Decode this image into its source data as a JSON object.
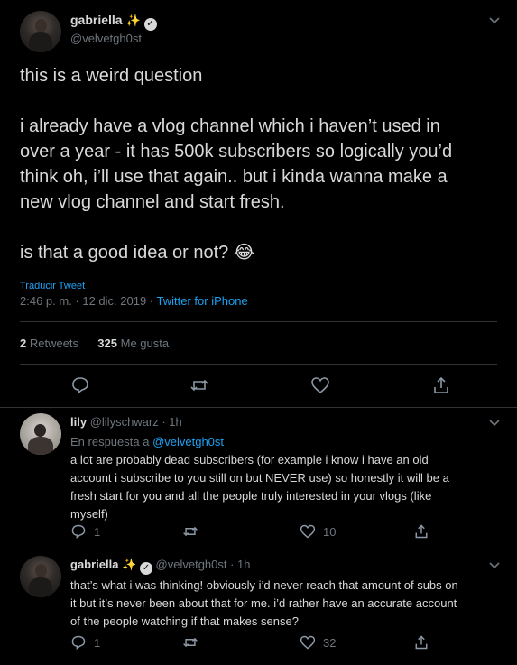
{
  "main_tweet": {
    "display_name": "gabriella",
    "handle": "@velvetgh0st",
    "text_line1": "this is a weird question",
    "text_para2_l1": "i already have a vlog channel which i haven’t used in",
    "text_para2_l2": "over a year - it has 500k subscribers so logically you’d",
    "text_para2_l3": "think oh, i’ll use that again.. but i kinda wanna make a",
    "text_para2_l4": "new vlog channel and start fresh.",
    "text_para3": "is that a good idea or not?",
    "emoji": "😂",
    "translate": "Traducir Tweet",
    "time": "2:46 p. m. · 12 dic. 2019 · ",
    "source": "Twitter for iPhone",
    "retweets_count": "2",
    "retweets_label": " Retweets",
    "likes_count": "325",
    "likes_label": " Me gusta"
  },
  "replies": [
    {
      "display_name": "lily",
      "handle_time": "@lilyschwarz · 1h",
      "reply_prefix": "En respuesta a ",
      "reply_to": "@velvetgh0st",
      "l1": "a lot are probably dead subscribers (for example i know i have an old",
      "l2": "account i subscribe to you still on but NEVER use) so honestly it will be a",
      "l3": "fresh start for you and all the people truly interested in your vlogs (like",
      "l4": "myself)",
      "reply_count": "1",
      "like_count": "10"
    },
    {
      "display_name": "gabriella",
      "handle_time": "@velvetgh0st · 1h",
      "l1": "that’s what i was thinking! obviously i’d never reach that amount of subs on",
      "l2": "it but it’s never been about that for me. i’d rather have an accurate account",
      "l3": "of the people watching if that makes sense?",
      "reply_count": "1",
      "like_count": "32"
    }
  ],
  "icons": {
    "reply": "reply-icon",
    "retweet": "retweet-icon",
    "like": "heart-icon",
    "share": "share-icon",
    "more": "chevron-down-icon",
    "verified": "verified-badge-icon"
  },
  "colors": {
    "background": "#000000",
    "text": "#d9d9d9",
    "muted": "#6e767d",
    "link": "#1da1f2",
    "separator": "#2f3336"
  }
}
